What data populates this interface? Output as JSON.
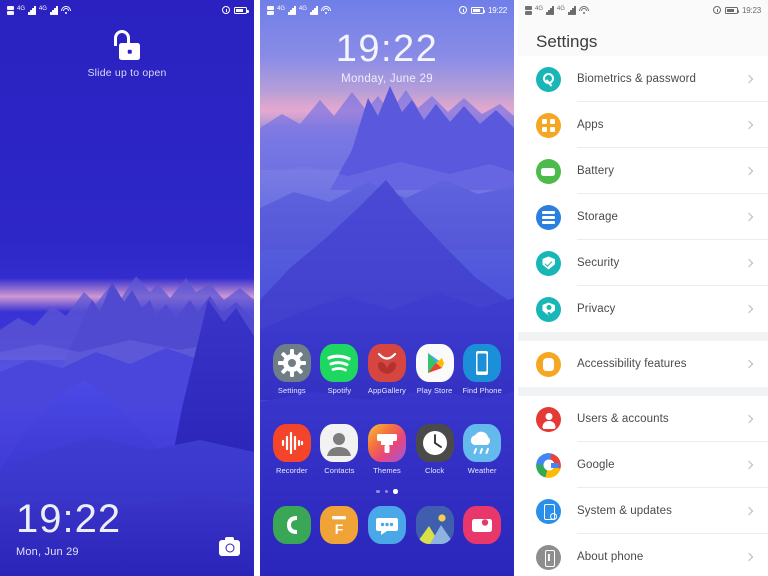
{
  "lockscreen": {
    "status": {
      "carrier_icons": [
        "sim-signal-icon",
        "signal-bars-icon",
        "signal-bars-icon",
        "wifi-icon"
      ],
      "alarm": "alarm-icon",
      "battery": "battery-icon",
      "time": ""
    },
    "unlock_hint": "Slide up to open",
    "unlock_icon": "open-padlock-icon",
    "time": "19:22",
    "date": "Mon, Jun 29",
    "camera_icon": "camera-shortcut-icon"
  },
  "homescreen": {
    "status": {
      "time": "19:22"
    },
    "time": "19:22",
    "date": "Monday, June 29",
    "apps_row1": [
      {
        "label": "Settings",
        "icon": "settings-gear-icon",
        "color": "#6e7d86"
      },
      {
        "label": "Spotify",
        "icon": "spotify-icon",
        "color": "#1ed760"
      },
      {
        "label": "AppGallery",
        "icon": "appgallery-icon",
        "color": "#d6453f"
      },
      {
        "label": "Play Store",
        "icon": "play-store-icon",
        "color": "#ffffff"
      },
      {
        "label": "Find Phone",
        "icon": "find-phone-icon",
        "color": "#1b8fd8"
      }
    ],
    "apps_row2": [
      {
        "label": "Recorder",
        "icon": "recorder-icon",
        "color": "#f4452b"
      },
      {
        "label": "Contacts",
        "icon": "contacts-icon",
        "color": "#f2f2f2"
      },
      {
        "label": "Themes",
        "icon": "themes-icon",
        "color": "#f47b42"
      },
      {
        "label": "Clock",
        "icon": "clock-icon",
        "color": "#4a4a4a"
      },
      {
        "label": "Weather",
        "icon": "weather-icon",
        "color": "#64b9ed"
      }
    ],
    "dock": [
      {
        "label": "Phone",
        "icon": "phone-icon",
        "color": "#3aa757"
      },
      {
        "label": "Files",
        "icon": "files-icon",
        "color": "#f0a336"
      },
      {
        "label": "Messages",
        "icon": "messages-icon",
        "color": "#4aa8e8"
      },
      {
        "label": "Gallery",
        "icon": "gallery-icon",
        "color": "#4e79c4"
      },
      {
        "label": "Camera",
        "icon": "camera-icon",
        "color": "#e8386b"
      }
    ],
    "page_dots": {
      "count": 3,
      "active": 3
    }
  },
  "settings": {
    "status": {
      "time": "19:23"
    },
    "title": "Settings",
    "groups": [
      {
        "items": [
          {
            "label": "Biometrics & password",
            "icon": "fingerprint-key-icon",
            "color": "#18b6b6",
            "glyph": "key"
          },
          {
            "label": "Apps",
            "icon": "apps-grid-icon",
            "color": "#f5a623",
            "glyph": "apps"
          },
          {
            "label": "Battery",
            "icon": "battery-icon",
            "color": "#4cbb4c",
            "glyph": "batt"
          },
          {
            "label": "Storage",
            "icon": "storage-icon",
            "color": "#2a7fe0",
            "glyph": "stor"
          },
          {
            "label": "Security",
            "icon": "shield-check-icon",
            "color": "#18b6b6",
            "glyph": "sec"
          },
          {
            "label": "Privacy",
            "icon": "shield-person-icon",
            "color": "#18b6b6",
            "glyph": "priv"
          }
        ]
      },
      {
        "items": [
          {
            "label": "Accessibility features",
            "icon": "hand-icon",
            "color": "#f5a623",
            "glyph": "acc"
          }
        ]
      },
      {
        "items": [
          {
            "label": "Users & accounts",
            "icon": "person-icon",
            "color": "#e53935",
            "glyph": "user"
          },
          {
            "label": "Google",
            "icon": "google-icon",
            "color": "#4285f4",
            "glyph": "goog"
          },
          {
            "label": "System & updates",
            "icon": "phone-settings-icon",
            "color": "#2a8fe8",
            "glyph": "sys"
          },
          {
            "label": "About phone",
            "icon": "phone-info-icon",
            "color": "#8e8e8e",
            "glyph": "about"
          }
        ]
      }
    ],
    "chevron_icon": "chevron-right-icon"
  }
}
